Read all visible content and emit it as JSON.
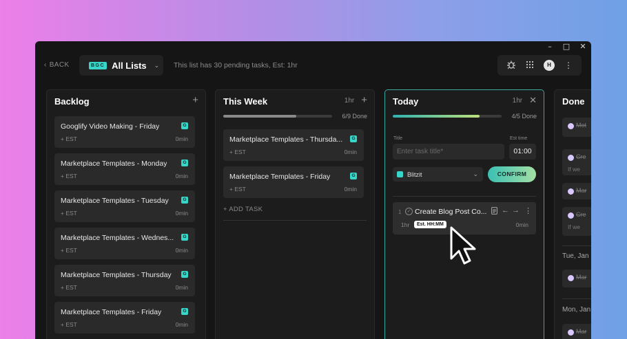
{
  "window_controls": {
    "minimize": "–",
    "maximize": "□",
    "close": "✕"
  },
  "topbar": {
    "back_label": "BACK",
    "list_badge": "BGC",
    "list_name": "All Lists",
    "pending_text": "This list has 30 pending tasks, Est: 1hr",
    "avatar_initial": "H"
  },
  "columns": {
    "backlog": {
      "title": "Backlog",
      "cards": [
        {
          "title": "Googlify Video Making - Friday",
          "badge": "G",
          "est": "+ EST",
          "time": "0min"
        },
        {
          "title": "Marketplace Templates - Monday",
          "badge": "G",
          "est": "+ EST",
          "time": "0min"
        },
        {
          "title": "Marketplace Templates - Tuesday",
          "badge": "G",
          "est": "+ EST",
          "time": "0min"
        },
        {
          "title": "Marketplace Templates - Wednes...",
          "badge": "G",
          "est": "+ EST",
          "time": "0min"
        },
        {
          "title": "Marketplace Templates - Thursday",
          "badge": "G",
          "est": "+ EST",
          "time": "0min"
        },
        {
          "title": "Marketplace Templates - Friday",
          "badge": "G",
          "est": "+ EST",
          "time": "0min"
        }
      ]
    },
    "this_week": {
      "title": "This Week",
      "est": "1hr",
      "progress_fraction": 0.67,
      "done_text": "6/9 Done",
      "cards": [
        {
          "title": "Marketplace Templates - Thursda...",
          "badge": "G",
          "est": "+ EST",
          "time": "0min"
        },
        {
          "title": "Marketplace Templates - Friday",
          "badge": "G",
          "est": "+ EST",
          "time": "0min"
        }
      ],
      "add_task": "+ ADD TASK"
    },
    "today": {
      "title": "Today",
      "est": "1hr",
      "progress_fraction": 0.8,
      "done_text": "4/5 Done",
      "form": {
        "title_label": "Title",
        "title_placeholder": "Enter task title*",
        "est_label": "Est time",
        "est_value": "01:00",
        "project": "Blitzit",
        "confirm_label": "CONFIRM"
      },
      "task": {
        "index": "1",
        "title": "Create Blog Post Co...",
        "est": "1hr",
        "tooltip": "Est. HH:MM",
        "time": "0min"
      }
    },
    "done": {
      "title": "Done",
      "cards": [
        {
          "title": "Mot",
          "sub": ""
        },
        {
          "title": "Cre",
          "sub": "If we"
        },
        {
          "title": "Mar",
          "sub": ""
        },
        {
          "title": "Cre",
          "sub": "If we"
        }
      ],
      "groups": [
        {
          "date": "Tue, Jan",
          "title": "Mar"
        },
        {
          "date": "Mon, Jan",
          "title": "Mar"
        }
      ]
    }
  }
}
